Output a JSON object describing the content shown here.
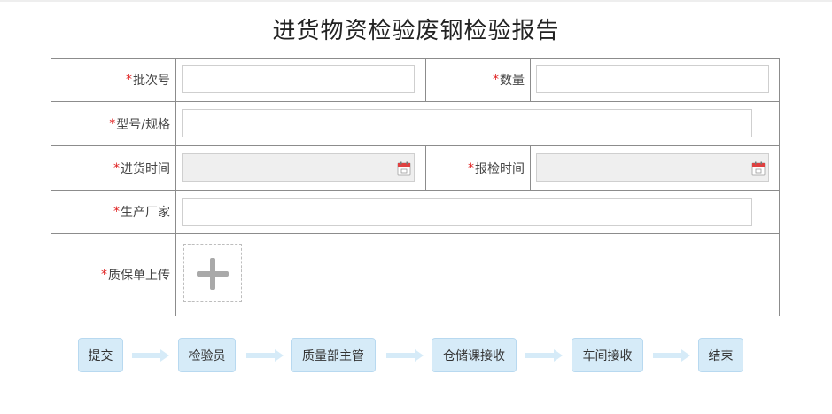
{
  "title": "进货物资检验废钢检验报告",
  "required_mark": "*",
  "fields": {
    "batch_no": {
      "label": "批次号",
      "value": ""
    },
    "quantity": {
      "label": "数量",
      "value": ""
    },
    "model_spec": {
      "label": "型号/规格",
      "value": ""
    },
    "incoming_time": {
      "label": "进货时间",
      "value": ""
    },
    "inspection_time": {
      "label": "报检时间",
      "value": ""
    },
    "manufacturer": {
      "label": "生产厂家",
      "value": ""
    },
    "quality_cert_upload": {
      "label": "质保单上传"
    }
  },
  "icons": {
    "calendar": "calendar-icon",
    "upload": "plus-icon",
    "flow_arrow": "arrow-right-icon"
  },
  "colors": {
    "required": "#e02020",
    "step_bg": "#d6ebf8",
    "arrow": "#d6ebf8"
  },
  "workflow": {
    "steps": [
      "提交",
      "检验员",
      "质量部主管",
      "仓储课接收",
      "车间接收",
      "结束"
    ]
  }
}
